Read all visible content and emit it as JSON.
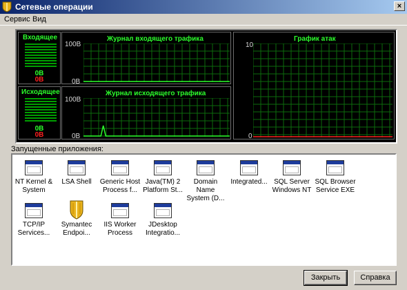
{
  "window": {
    "title": "Сетевые операции",
    "close_glyph": "×"
  },
  "menu": [
    {
      "label": "Сервис"
    },
    {
      "label": "Вид"
    }
  ],
  "traffic": {
    "incoming": {
      "label": "Входящее",
      "value": "0B",
      "value_red": "0B"
    },
    "outgoing": {
      "label": "Исходящее",
      "value": "0B",
      "value_red": "0B"
    },
    "incoming_log": {
      "title": "Журнал входящего трафика",
      "y_max": "100B",
      "y_min": "0B",
      "values": [
        0,
        0,
        0,
        0,
        0,
        0,
        0,
        0,
        0,
        0,
        0,
        0,
        0,
        0,
        0,
        0,
        0,
        0,
        0,
        0,
        0,
        0,
        0,
        0,
        0,
        0,
        0,
        0,
        0,
        0,
        0,
        0,
        0,
        0,
        0,
        0,
        0,
        0,
        0,
        0,
        0,
        0,
        0,
        0,
        0,
        0,
        0,
        0,
        0,
        0,
        0,
        0,
        0,
        0,
        0,
        0,
        0,
        0,
        0,
        0
      ]
    },
    "outgoing_log": {
      "title": "Журнал исходящего трафика",
      "y_max": "100B",
      "y_min": "0B",
      "values": [
        0,
        0,
        0,
        0,
        0,
        0,
        0,
        0,
        0,
        0,
        0,
        0,
        0,
        0,
        0,
        0,
        0,
        0,
        0,
        0,
        0,
        0,
        0,
        0,
        0,
        0,
        0,
        0,
        0,
        0,
        0,
        0,
        0,
        0,
        0,
        0,
        0,
        0,
        0,
        0,
        0,
        0,
        0,
        0,
        0,
        0,
        0,
        0,
        0,
        0,
        0,
        0,
        0,
        0,
        0,
        0,
        0,
        0,
        0,
        0
      ]
    },
    "outgoing_spike": {
      "index": 8,
      "value": 28
    }
  },
  "attacks": {
    "title": "График атак",
    "y_max": "10",
    "y_min": "0"
  },
  "colors": {
    "grid": "#0d6b0d",
    "label": "#2cff2c",
    "alert": "#ff2020"
  },
  "apps_label": "Запущенные приложения:",
  "apps": [
    {
      "line1": "NT Kernel &",
      "line2": "System",
      "icon": "window-icon"
    },
    {
      "line1": "LSA Shell",
      "line2": "",
      "icon": "window-icon"
    },
    {
      "line1": "Generic Host",
      "line2": "Process f...",
      "icon": "window-icon"
    },
    {
      "line1": "Java(TM) 2",
      "line2": "Platform St...",
      "icon": "window-icon"
    },
    {
      "line1": "Domain Name",
      "line2": "System (D...",
      "icon": "window-icon"
    },
    {
      "line1": "Integrated...",
      "line2": "",
      "icon": "window-icon"
    },
    {
      "line1": "SQL Server",
      "line2": "Windows NT",
      "icon": "window-icon"
    },
    {
      "line1": "SQL Browser",
      "line2": "Service EXE",
      "icon": "window-icon"
    },
    {
      "line1": "TCP/IP",
      "line2": "Services...",
      "icon": "window-icon"
    },
    {
      "line1": "Symantec",
      "line2": "Endpoi...",
      "icon": "shield-icon"
    },
    {
      "line1": "IIS Worker",
      "line2": "Process",
      "icon": "window-icon"
    },
    {
      "line1": "JDesktop",
      "line2": "Integratio...",
      "icon": "window-icon"
    }
  ],
  "buttons": {
    "close": "Закрыть",
    "help": "Справка"
  }
}
